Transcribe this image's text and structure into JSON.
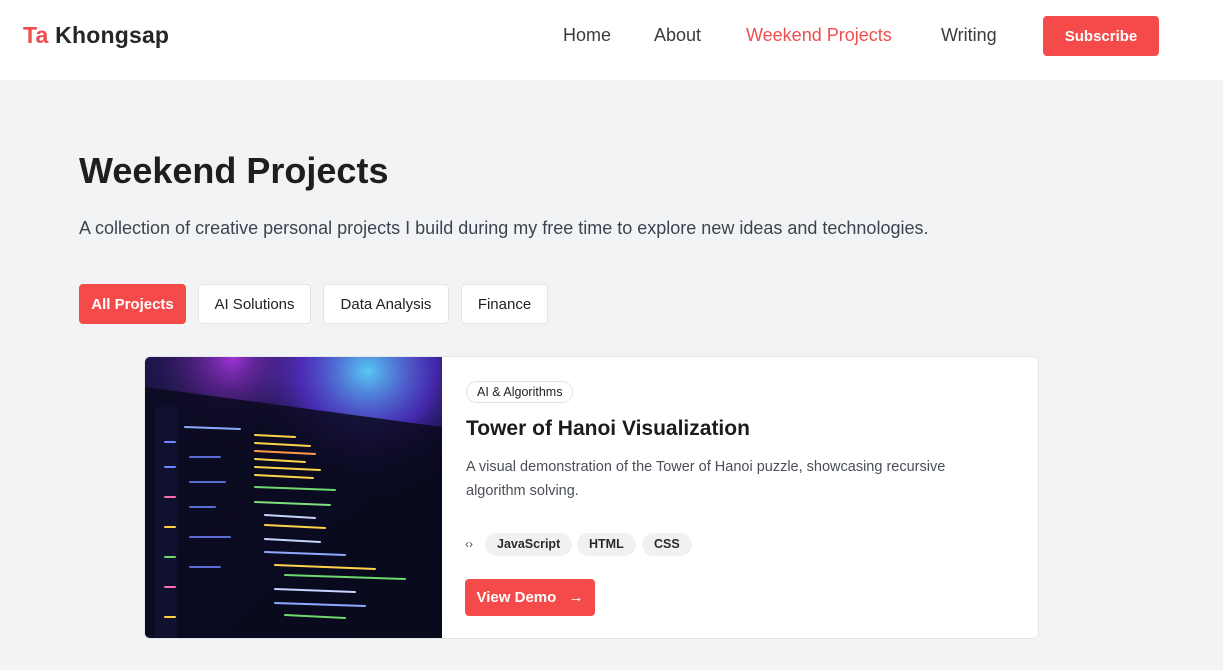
{
  "header": {
    "logo_first": "Ta",
    "logo_last": "Khongsap",
    "nav": [
      "Home",
      "About",
      "Weekend Projects",
      "Writing"
    ],
    "active_nav": "Weekend Projects",
    "subscribe_label": "Subscribe"
  },
  "main": {
    "title": "Weekend Projects",
    "description": "A collection of creative personal projects I build during my free time to explore new ideas and technologies.",
    "filters": [
      "All Projects",
      "AI Solutions",
      "Data Analysis",
      "Finance"
    ],
    "active_filter": "All Projects"
  },
  "project": {
    "category": "AI & Algorithms",
    "title": "Tower of Hanoi Visualization",
    "description": "A visual demonstration of the Tower of Hanoi puzzle, showcasing recursive algorithm solving.",
    "tech_icon": "code-icon",
    "tech": [
      "JavaScript",
      "HTML",
      "CSS"
    ],
    "button_label": "View Demo",
    "button_icon": "arrow-right-icon",
    "image": "code-editor-screenshot"
  },
  "colors": {
    "accent": "#f44a4a",
    "background": "#f2f3f5"
  }
}
